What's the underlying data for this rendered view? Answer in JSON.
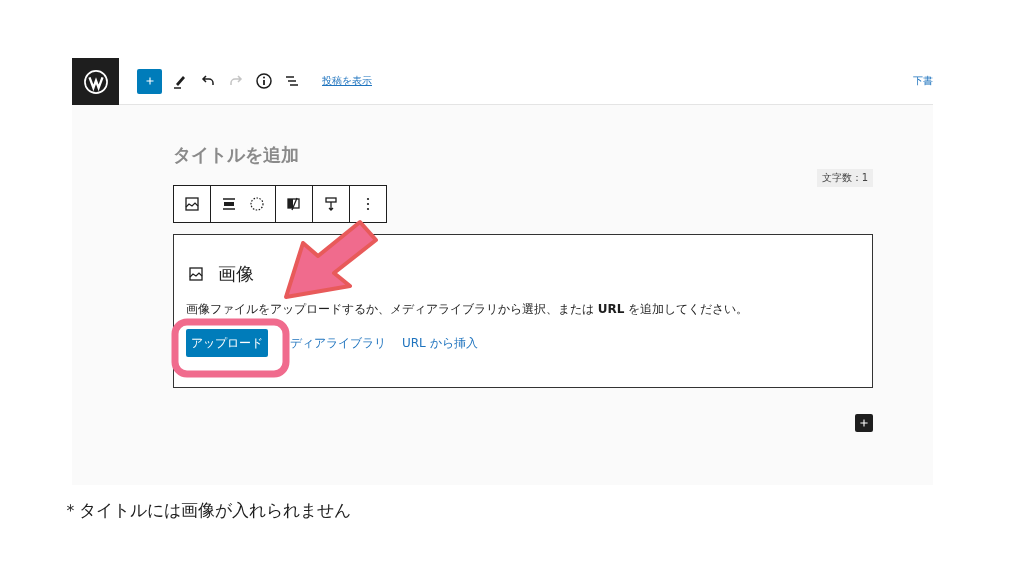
{
  "top_bar": {
    "view_post_link": "投稿を表示",
    "save_draft": "下書",
    "history": [
      {
        "kind": "undo",
        "disabled": false
      },
      {
        "kind": "redo",
        "disabled": true
      }
    ]
  },
  "editor": {
    "title_placeholder": "タイトルを追加",
    "word_count": "文字数：1",
    "block": {
      "title": "画像",
      "instructions": "画像ファイルをアップロードするか、メディアライブラリから選択、または **URL** を追加してください。",
      "buttons": [
        {
          "label": "アップロード",
          "kind": "primary"
        },
        {
          "label": "ディアライブラリ",
          "kind": "link"
        },
        {
          "label": "URL から挿入",
          "kind": "link"
        }
      ]
    }
  },
  "caption": "＊タイトルには画像が入れられません"
}
